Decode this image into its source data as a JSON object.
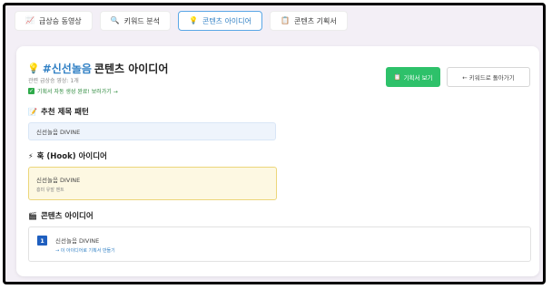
{
  "tabs": [
    {
      "icon": "📈",
      "label": "급상승 동영상"
    },
    {
      "icon": "🔍",
      "label": "키워드 분석"
    },
    {
      "icon": "💡",
      "label": "콘텐츠 아이디어"
    },
    {
      "icon": "📋",
      "label": "콘텐츠 기획서"
    }
  ],
  "header": {
    "bulb": "💡",
    "keyword": "#신선놀음",
    "title_suffix": "콘텐츠 아이디어",
    "meta": "관련 급상승 영상: 1개",
    "success_check": "✓",
    "success_text": "기획서 자동 생성 완료! 보러가기 →"
  },
  "actions": {
    "view_plan_icon": "📋",
    "view_plan_label": "기획서 보기",
    "back_label": "← 키워드로 돌아가기"
  },
  "sections": {
    "title_patterns": {
      "icon": "📝",
      "heading": "추천 제목 패턴",
      "items": [
        "신선놀음 DIVINE"
      ]
    },
    "hook": {
      "icon": "⚡",
      "heading": "훅 (Hook) 아이디어",
      "title": "신선놀음 DIVINE",
      "sub": "흥미 유발 멘트"
    },
    "ideas": {
      "icon": "🎬",
      "heading": "콘텐츠 아이디어",
      "number": "1",
      "title": "신선놀음 DIVINE",
      "link": "→ 이 아이디어로 기획서 만들기"
    }
  },
  "colors": {
    "accent_blue": "#2f7fc4",
    "success_green": "#2ec16a",
    "hook_bg": "#fdf8e2",
    "pattern_bg": "#eef4fc"
  }
}
